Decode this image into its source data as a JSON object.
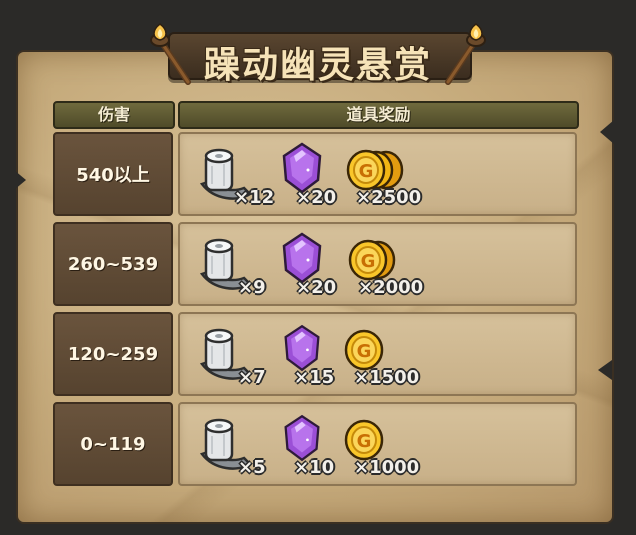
{
  "title": "躁动幽灵悬赏",
  "headers": {
    "damage": "伤害",
    "reward": "道具奖励"
  },
  "colors": {
    "bandage": "#cfd2d4",
    "gem": "#9b4fd6",
    "coin": "#f2b614"
  },
  "icons": {
    "item1": "bandage-roll-icon",
    "item2": "purple-gem-icon",
    "item3": "gold-coin-icon"
  },
  "rows": [
    {
      "damage": "540以上",
      "bandage_qty": "×12",
      "gem_qty": "×20",
      "coin_qty": "×2500"
    },
    {
      "damage": "260~539",
      "bandage_qty": "×9",
      "gem_qty": "×20",
      "coin_qty": "×2000"
    },
    {
      "damage": "120~259",
      "bandage_qty": "×7",
      "gem_qty": "×15",
      "coin_qty": "×1500"
    },
    {
      "damage": "0~119",
      "bandage_qty": "×5",
      "gem_qty": "×10",
      "coin_qty": "×1000"
    }
  ]
}
